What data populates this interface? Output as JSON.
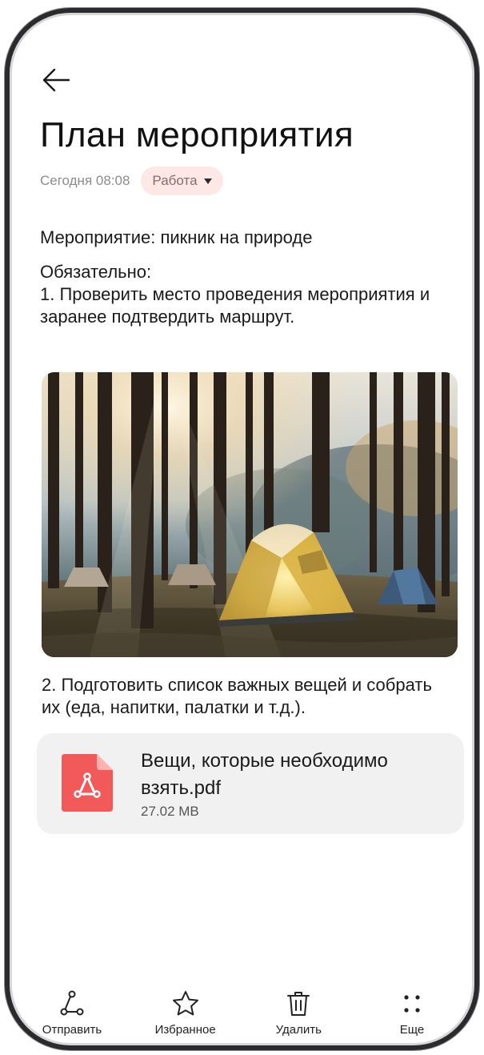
{
  "note": {
    "title": "План мероприятия",
    "date": "Сегодня 08:08",
    "category": "Работа",
    "line1": "Мероприятие: пикник на природе",
    "line2": "Обязательно:\n1. Проверить место проведения мероприятия и заранее подтвердить маршрут.",
    "line3": "2. Подготовить список важных вещей и собрать их (еда, напитки, палатки и т.д.)."
  },
  "attachment": {
    "name": "Вещи, которые необходимо взять.pdf",
    "size": "27.02 MB",
    "icon": "pdf-icon",
    "icon_color": "#f25a5a"
  },
  "toolbar": {
    "share_label": "Отправить",
    "favorite_label": "Избранное",
    "delete_label": "Удалить",
    "more_label": "Еще"
  },
  "icons": {
    "back": "arrow-left-icon",
    "share": "share-icon",
    "favorite": "star-icon",
    "delete": "trash-icon",
    "more": "more-dots-icon"
  }
}
